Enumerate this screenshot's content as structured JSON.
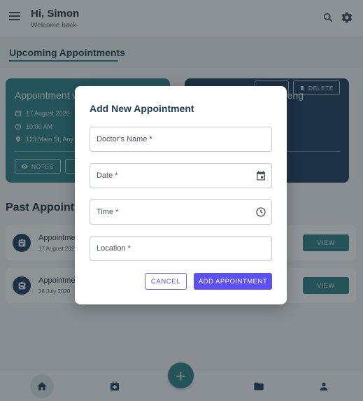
{
  "header": {
    "greeting": "Hi, Simon",
    "subtitle": "Welcome back",
    "icons": {
      "menu": "menu-icon",
      "search": "search-icon",
      "settings": "gear-icon"
    }
  },
  "tabs": {
    "active_label": "Upcoming Appointments"
  },
  "upcoming": [
    {
      "title": "Appointment w",
      "date": "17 August 2020",
      "time": "10:00 AM",
      "location": "123 Main St, Any",
      "buttons": [
        "NOTES",
        ""
      ],
      "color": "#2a7f86"
    },
    {
      "title": "eng",
      "buttons": [
        "",
        "DELETE"
      ],
      "color": "#1c3a5a"
    }
  ],
  "past": {
    "section_title": "Past Appointr",
    "items": [
      {
        "title": "Appointme",
        "date": "17 August 202",
        "action": "VIEW"
      },
      {
        "title": "Appointme",
        "date": "26 July 2020",
        "action": "VIEW"
      }
    ]
  },
  "bottom_nav": {
    "items": [
      "home-icon",
      "health-icon",
      "folder-icon",
      "user-icon"
    ],
    "fab": "+"
  },
  "dialog": {
    "title": "Add New Appointment",
    "fields": [
      {
        "label": "Doctor's Name *",
        "icon": ""
      },
      {
        "label": "Date *",
        "icon": "calendar-icon"
      },
      {
        "label": "Time *",
        "icon": "clock-icon"
      },
      {
        "label": "Location *",
        "icon": ""
      }
    ],
    "cancel_label": "CANCEL",
    "submit_label": "ADD APPOINTMENT"
  },
  "colors": {
    "primary_teal": "#2a7f86",
    "navy": "#1c3a5a",
    "dialog_accent": "#5d50f2"
  }
}
